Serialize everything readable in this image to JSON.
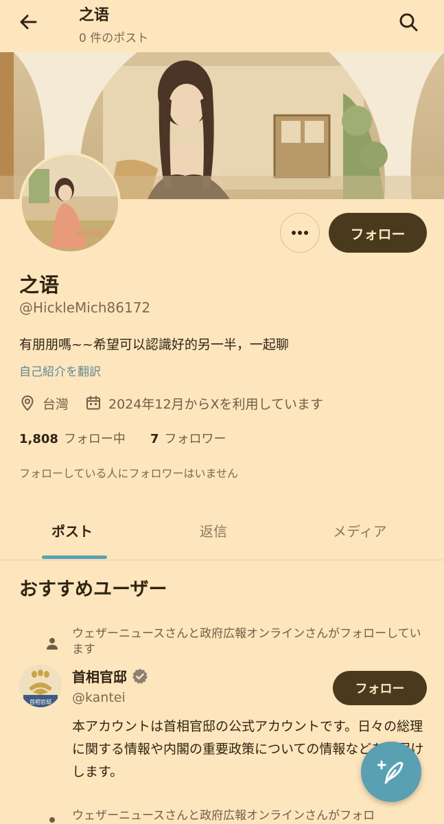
{
  "topbar": {
    "title": "之语",
    "post_count": "0 件のポスト",
    "back_icon": "arrow-left-icon",
    "search_icon": "search-icon"
  },
  "profile": {
    "display_name": "之语",
    "handle": "@HickleMich86172",
    "bio": "有朋朋嗎~~希望可以認識好的另一半，一起聊",
    "translate_link": "自己紹介を翻訳",
    "location": "台灣",
    "joined": "2024年12月からXを利用しています",
    "following_count": "1,808",
    "following_label": "フォロー中",
    "followers_count": "7",
    "followers_label": "フォロワー",
    "no_mutual": "フォローしている人にフォロワーはいません",
    "follow_label": "フォロー",
    "more_icon": "more-horizontal-icon"
  },
  "tabs": [
    {
      "label": "ポスト",
      "active": true
    },
    {
      "label": "返信",
      "active": false
    },
    {
      "label": "メディア",
      "active": false
    }
  ],
  "recommended": {
    "heading": "おすすめユーザー",
    "users": [
      {
        "social_context": "ウェザーニュースさんと政府広報オンラインさんがフォローしています",
        "name": "首相官邸",
        "handle": "@kantei",
        "verified": true,
        "follow_label": "フォロー",
        "bio": "本アカウントは首相官邸の公式アカウントです。日々の総理に関する情報や内閣の重要政策についての情報などをお届けします。",
        "avatar_text": "首相官邸"
      },
      {
        "social_context": "ウェザーニュースさんと政府広報オンラインさんがフォロ"
      }
    ]
  },
  "fab": {
    "icon": "compose-post-icon"
  },
  "colors": {
    "background": "#fde5bd",
    "primary_button": "#4a3a1d",
    "accent": "#5aa0b3",
    "link": "#5f8a98"
  }
}
